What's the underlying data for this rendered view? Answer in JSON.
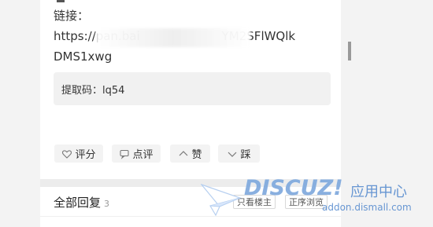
{
  "post": {
    "link_label": "链接：",
    "url_line1_start": "https://pan.bai",
    "url_line1_end": "YM2SFlWQlk",
    "url_line2": "DMS1xwg",
    "extraction_code": "提取码：lq54"
  },
  "actions": {
    "rate": "评分",
    "comment": "点评",
    "like": "赞",
    "dislike": "踩"
  },
  "replies": {
    "title": "全部回复",
    "count": "3",
    "only_author": "只看楼主",
    "order": "正序浏览"
  },
  "watermark": {
    "logo": "DISCUZ!",
    "subtitle": "应用中心",
    "url": "addon.dismall.com"
  },
  "colors": {
    "watermark_blue": "#5c8fd0",
    "button_bg": "#f3f3f3",
    "code_bg": "#f1f1f1"
  },
  "icons": {
    "rate": "heart-icon",
    "comment": "comment-icon",
    "like": "chevron-up-icon",
    "dislike": "chevron-down-icon"
  }
}
